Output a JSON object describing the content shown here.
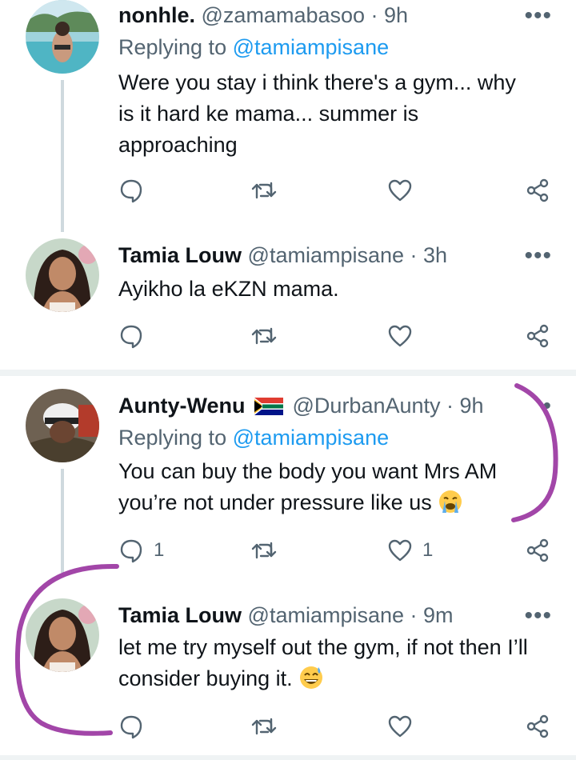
{
  "tweets": [
    {
      "name": "nonhle.",
      "handle": "@zamamabasoo · 9h",
      "replying_prefix": "Replying to",
      "replying_to": "@tamiampisane",
      "text_lines": [
        "Were you stay i think there's a gym... why",
        "is it hard ke mama... summer is",
        "approaching"
      ],
      "more": "•••"
    },
    {
      "name": "Tamia Louw",
      "handle": "@tamiampisane · 3h",
      "text_lines": [
        "Ayikho la eKZN mama."
      ],
      "more": "•••"
    },
    {
      "name": "Aunty-Wenu",
      "handle": "@DurbanAunty · 9h",
      "replying_prefix": "Replying to",
      "replying_to": "@tamiampisane",
      "text_lines": [
        "You can buy the body you want Mrs AM",
        "you’re not under pressure like us"
      ],
      "reply_count": "1",
      "like_count": "1",
      "more": "•"
    },
    {
      "name": "Tamia Louw",
      "handle": "@tamiampisane · 9m",
      "text_lines": [
        "let me try myself out the gym, if not then I’ll",
        "consider buying it."
      ],
      "more": "•••"
    }
  ],
  "icons": {
    "reply": "speech-bubble-icon",
    "retweet": "retweet-icon",
    "like": "heart-icon",
    "share": "share-icon",
    "flag": "south-africa-flag-icon",
    "emoji_cry": "loudly-crying-face-icon",
    "emoji_sweat": "grinning-face-with-sweat-icon"
  },
  "colors": {
    "link": "#1d9bf0",
    "secondary": "#536471",
    "annotation": "#a246a8"
  }
}
